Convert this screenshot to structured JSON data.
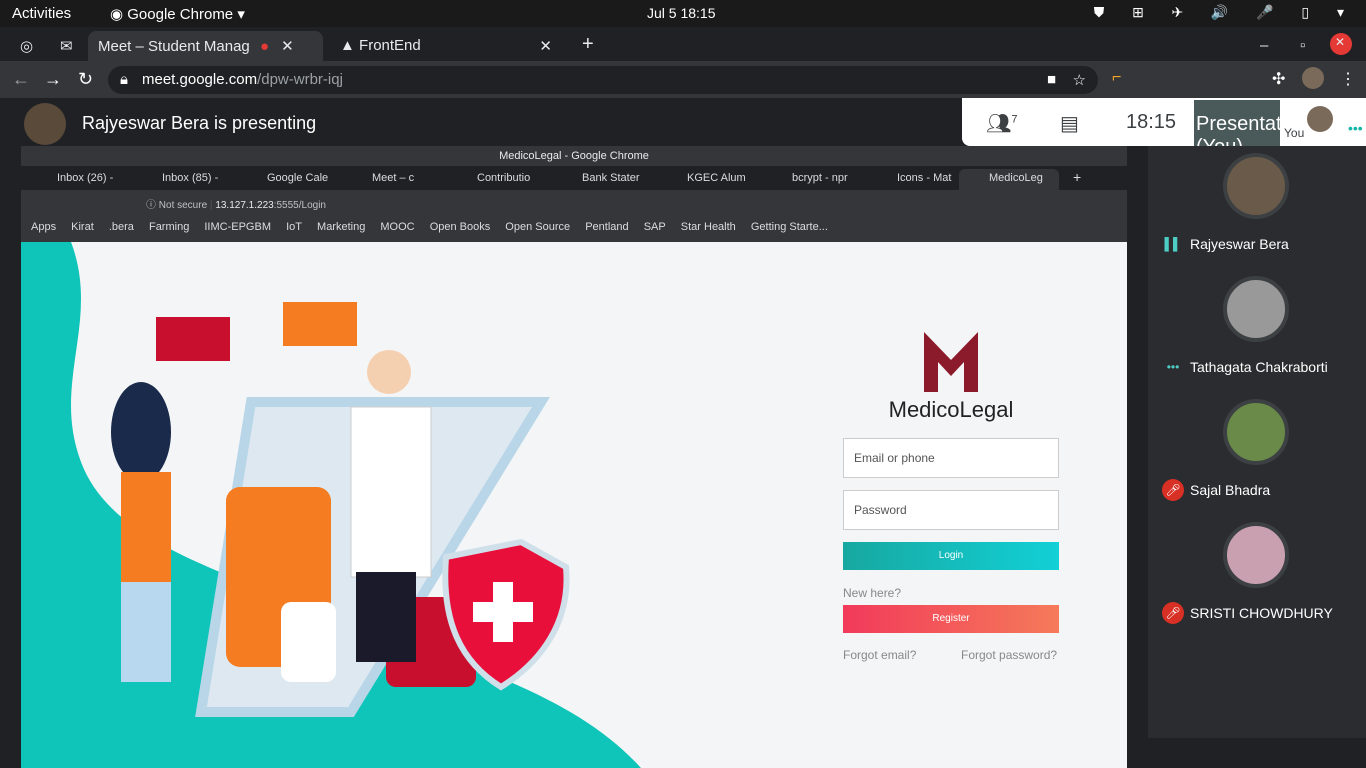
{
  "os_bar": {
    "activities": "Activities",
    "app": "Google Chrome",
    "clock": "Jul 5  18:15"
  },
  "browser_tabs": [
    {
      "label": "Meet – Student Manag"
    },
    {
      "label": "FrontEnd"
    }
  ],
  "url": {
    "host": "meet.google.com",
    "path": "/dpw-wrbr-iqj"
  },
  "meet": {
    "presenter_text": "Rajyeswar Bera is presenting",
    "people_count": "7",
    "time": "18:15",
    "presentation_label": "Presentation (You)",
    "you_label": "You"
  },
  "participants": [
    {
      "name": "Rajyeswar Bera",
      "status": "speaking"
    },
    {
      "name": "Tathagata Chakraborti",
      "status": "more"
    },
    {
      "name": "Sajal Bhadra",
      "status": "muted"
    },
    {
      "name": "SRISTI CHOWDHURY",
      "status": "muted"
    }
  ],
  "shared": {
    "window_title": "MedicoLegal - Google Chrome",
    "tabs": [
      "Inbox (26) -",
      "Inbox (85) -",
      "Google Cale",
      "Meet – c",
      "Contributio",
      "Bank Stater",
      "KGEC Alum",
      "bcrypt - npr",
      "Icons - Mat",
      "MedicoLeg"
    ],
    "address": {
      "security": "Not secure",
      "host": "13.127.1.223",
      "path": ":5555/Login"
    },
    "bookmarks": [
      "Apps",
      "Kirat",
      ".bera",
      "Farming",
      "IIMC-EPGBM",
      "IoT",
      "Marketing",
      "MOOC",
      "Open Books",
      "Open Source",
      "Pentland",
      "SAP",
      "Star Health",
      "Getting Starte..."
    ],
    "login": {
      "brand": "MedicoLegal",
      "email_placeholder": "Email or phone",
      "password_placeholder": "Password",
      "login_label": "Login",
      "new_here": "New here?",
      "register_label": "Register",
      "forgot_email": "Forgot email?",
      "forgot_password": "Forgot password?"
    }
  },
  "colors": {
    "accent_teal": "#12c4c0",
    "accent_red": "#f23a5a",
    "brand_maroon": "#8b1a2a"
  }
}
